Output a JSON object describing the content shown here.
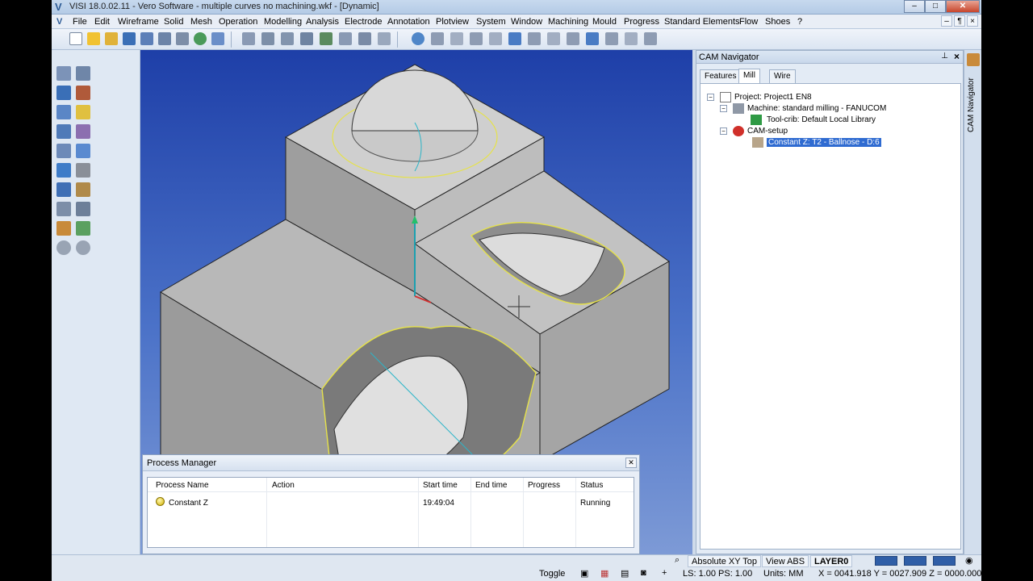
{
  "window": {
    "title": "VISI 18.0.02.11 - Vero Software - multiple curves no machining.wkf - [Dynamic]",
    "min_label": "–",
    "max_label": "□",
    "close_label": "✕"
  },
  "menu": [
    "File",
    "Edit",
    "Wireframe",
    "Solid",
    "Mesh",
    "Operation",
    "Modelling",
    "Analysis",
    "Electrode",
    "Annotation",
    "Plotview",
    "System",
    "Window",
    "Machining",
    "Mould",
    "Progress",
    "Standard Elements",
    "Flow",
    "Shoes",
    "?"
  ],
  "mdi_controls": [
    "–",
    "¶",
    "×"
  ],
  "process_manager": {
    "title": "Process Manager",
    "columns": [
      "Process Name",
      "Action",
      "Start time",
      "End time",
      "Progress",
      "Status"
    ],
    "rows": [
      {
        "name": "Constant Z",
        "action": "",
        "start": "19:49:04",
        "end": "",
        "progress": "",
        "status": "Running"
      }
    ]
  },
  "cam_navigator": {
    "title": "CAM Navigator",
    "tabs": [
      "Features",
      "Mill",
      "Wire"
    ],
    "active_tab": "Mill",
    "tree": {
      "project": "Project: Project1 EN8",
      "machine": "Machine: standard milling - FANUCOM",
      "toolcrib": "Tool-crib: Default Local Library",
      "setup": "CAM-setup",
      "operation": "Constant Z: T2 - Ballnose - D:6"
    },
    "side_tab": "CAM Navigator"
  },
  "statusbar": {
    "view_name": "Absolute XY Top",
    "view_abs": "View ABS",
    "layer": "LAYER0",
    "toggle": "Toggle",
    "ls_ps": "LS: 1.00 PS: 1.00",
    "units": "Units: MM",
    "coords": "X = 0041.918 Y = 0027.909 Z = 0000.000"
  },
  "colors": {
    "viewport_top": "#1e3fa8",
    "model_grey": "#b9b9b9",
    "edge_yellow": "#e6e24a",
    "selection": "#2f6bd1"
  }
}
